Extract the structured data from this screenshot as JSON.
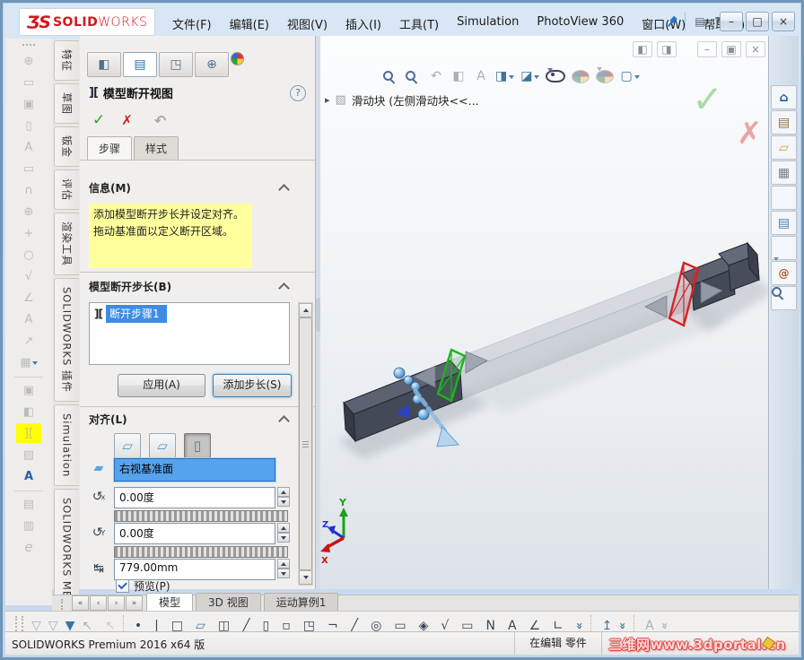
{
  "titlebar": {
    "logo": {
      "mark": "ƷS",
      "bold": "SOLID",
      "light": "WORKS"
    },
    "menus": [
      {
        "n": "menu-file",
        "label": "文件(F)"
      },
      {
        "n": "menu-edit",
        "label": "编辑(E)"
      },
      {
        "n": "menu-view",
        "label": "视图(V)"
      },
      {
        "n": "menu-insert",
        "label": "插入(I)"
      },
      {
        "n": "menu-tools",
        "label": "工具(T)"
      },
      {
        "n": "menu-simulation",
        "label": "Simulation"
      },
      {
        "n": "menu-photoview",
        "label": "PhotoView 360"
      },
      {
        "n": "menu-window",
        "label": "窗口(W)"
      },
      {
        "n": "menu-help",
        "label": "帮助(H)"
      }
    ],
    "quick": [
      {
        "n": "whats-new-icon",
        "g": "▤"
      },
      {
        "n": "help-icon",
        "g": "?"
      },
      {
        "n": "help-dropdown-icon",
        "g": "▾"
      }
    ],
    "controls": [
      {
        "n": "minimize-button",
        "g": "–"
      },
      {
        "n": "maximize-button",
        "g": "□"
      },
      {
        "n": "close-button",
        "g": "×"
      }
    ]
  },
  "left_toolbar": {
    "items": [
      {
        "n": "datum-target-icon",
        "g": "⊕"
      },
      {
        "n": "auto-dimension-icon",
        "g": "▭"
      },
      {
        "n": "basic-dimension-icon",
        "g": "▣"
      },
      {
        "n": "datum-feature-icon",
        "g": "▯"
      },
      {
        "n": "note-pattern-icon",
        "g": "A"
      },
      {
        "n": "dimension-frame-icon",
        "g": "▭"
      },
      {
        "n": "revision-cloud-icon",
        "g": "∩"
      },
      {
        "n": "target-point-icon",
        "g": "⊕"
      },
      {
        "n": "hide-show-annotations-icon",
        "g": "+"
      },
      {
        "n": "magnifying-glass-icon",
        "g": "○"
      },
      {
        "n": "spell-checker-icon",
        "g": "√"
      },
      {
        "n": "weld-symbol-icon",
        "g": "∠"
      },
      {
        "n": "note-icon",
        "g": "A"
      },
      {
        "n": "multi-jog-leader-icon",
        "g": "↗"
      },
      {
        "n": "table-icon",
        "g": "▦",
        "dd": true
      },
      {
        "sep": true
      },
      {
        "n": "camera-3d-icon",
        "g": "▣"
      },
      {
        "n": "section-view-icon",
        "g": "◧"
      },
      {
        "n": "model-break-view-button",
        "g": "][",
        "cls": "hl"
      },
      {
        "n": "display-state-icon",
        "g": "▧"
      },
      {
        "n": "annotation-view-icon",
        "g": "A",
        "cls": "colored"
      },
      {
        "sep": true
      },
      {
        "n": "publish-3dpdf-icon",
        "g": "▤"
      },
      {
        "n": "publish-stl-icon",
        "g": "▥"
      },
      {
        "n": "edrawings-icon",
        "g": "e",
        "cls": "ital"
      }
    ]
  },
  "command_tabs": {
    "items": [
      {
        "n": "tab-features",
        "label": "特征"
      },
      {
        "n": "tab-sketch",
        "label": "草图"
      },
      {
        "n": "tab-sheetmetal",
        "label": "钣金"
      },
      {
        "n": "tab-evaluate",
        "label": "评估"
      },
      {
        "n": "tab-render-tools",
        "label": "渲染工具"
      },
      {
        "n": "tab-solidworks-addins",
        "label": "SOLIDWORKS 插件"
      },
      {
        "n": "tab-simulation",
        "label": "Simulation"
      },
      {
        "n": "tab-solidworks-mbd",
        "label": "SOLIDWORKS MBD"
      }
    ]
  },
  "pm": {
    "manager_tabs": [
      {
        "n": "featuremanager-tab",
        "g": "◧"
      },
      {
        "n": "propertymanager-tab",
        "g": "▤",
        "cls": "active"
      },
      {
        "n": "configurationmanager-tab",
        "g": "◳"
      },
      {
        "n": "dimxpertmanager-tab",
        "g": "⊕"
      },
      {
        "n": "displaymanager-tab",
        "g": "",
        "cls": "ballicon"
      }
    ],
    "title": "模型断开视图",
    "title_icon": "][",
    "help": "?",
    "ok": "✓",
    "cancel": "✗",
    "undo": "↶",
    "subtabs": [
      {
        "n": "subtab-steps",
        "label": "步骤",
        "cls": "active"
      },
      {
        "n": "subtab-style",
        "label": "样式"
      }
    ],
    "info_header": "信息(M)",
    "info_line1": "添加模型断开步长并设定对齐。",
    "info_line2": "拖动基准面以定义断开区域。",
    "steps_header": "模型断开步长(B)",
    "step_icon": "][",
    "step_label": "断开步骤1",
    "apply": "应用(A)",
    "add_step": "添加步长(S)",
    "align_header": "对齐(L)",
    "align_buttons": [
      {
        "n": "align-with-xy-button",
        "g": "▱"
      },
      {
        "n": "align-with-xz-button",
        "g": "▱"
      },
      {
        "n": "align-with-plane-button",
        "g": "▯",
        "cls": "pressed"
      }
    ],
    "plane_icon": "▰",
    "plane_value": "右视基准面",
    "x_icon": "↺",
    "x_sup": "x",
    "x_value": "0.00度",
    "y_icon": "↺",
    "y_sup": "Y",
    "y_value": "0.00度",
    "dist_icon": "↹",
    "dist_value": "779.00mm",
    "preview_label": "预览(P)"
  },
  "viewport": {
    "doc_controls": [
      {
        "n": "pane-left-icon",
        "g": "◧"
      },
      {
        "n": "pane-right-icon",
        "g": "◨"
      },
      {
        "n": "doc-minimize-button",
        "g": "–",
        "cls": "mgap"
      },
      {
        "n": "doc-restore-button",
        "g": "▣"
      },
      {
        "n": "doc-close-button",
        "g": "×"
      }
    ],
    "headsup": [
      {
        "n": "zoom-fit-button",
        "cls": "magicon"
      },
      {
        "n": "zoom-area-button",
        "cls": "magicon"
      },
      {
        "n": "previous-view-button",
        "g": "↶",
        "cls": "grayg"
      },
      {
        "n": "section-view-button",
        "g": "◧",
        "cls": "grayg"
      },
      {
        "n": "annotation-views-button",
        "g": "A",
        "cls": "grayg"
      },
      {
        "n": "view-orientation-button",
        "g": "◨",
        "cls": "blueg",
        "dd": true
      },
      {
        "n": "display-style-button",
        "g": "◪",
        "cls": "blueg",
        "dd": true
      },
      {
        "n": "hide-show-items-button",
        "cls": "eyeicon",
        "dd": true
      },
      {
        "n": "edit-appearance-button",
        "cls": "ballicon dim"
      },
      {
        "n": "apply-scene-button",
        "cls": "ballicon dim",
        "dd": true
      },
      {
        "n": "view-settings-button",
        "g": "▢",
        "cls": "blueg",
        "dd": true
      }
    ],
    "breadcrumb": {
      "expander": "▸",
      "icon": "▧",
      "label": "滑动块 (左侧滑动块<<..."
    },
    "confirm_ok": "✓",
    "confirm_cancel": "✗",
    "triad": {
      "x": "X",
      "y": "Y",
      "z": "Z"
    }
  },
  "taskpane": {
    "items": [
      {
        "n": "resources-home-tab",
        "g": "⌂",
        "cls": "c-home"
      },
      {
        "n": "design-library-tab",
        "g": "▤",
        "cls": "c-lib"
      },
      {
        "n": "file-explorer-tab",
        "g": "▱",
        "cls": "c-folder"
      },
      {
        "n": "view-palette-tab",
        "g": "▦",
        "cls": "c-pal"
      },
      {
        "n": "appearances-tab",
        "g": "",
        "cls": "ballicon"
      },
      {
        "n": "custom-properties-tab",
        "g": "▤",
        "cls": "c-props"
      },
      {
        "n": "forum-tab",
        "g": "",
        "cls": "bubbleicon"
      },
      {
        "n": "xpress-products-tab",
        "g": "@",
        "cls": "c-at"
      },
      {
        "n": "search-tab",
        "g": "",
        "cls": "magicon"
      }
    ]
  },
  "doc_tabs": {
    "nav": [
      {
        "n": "first-tab-button",
        "g": "«"
      },
      {
        "n": "prev-tab-button",
        "g": "‹"
      },
      {
        "n": "next-tab-button",
        "g": "›"
      },
      {
        "n": "last-tab-button",
        "g": "»"
      }
    ],
    "tabs": [
      {
        "n": "tab-model",
        "label": "模型",
        "cls": "active"
      },
      {
        "n": "tab-3d-views",
        "label": "3D 视图"
      },
      {
        "n": "tab-motion-study",
        "label": "运动算例1"
      }
    ]
  },
  "bottom_toolbar": {
    "items": [
      {
        "n": "selection-filter-icon",
        "g": "▽",
        "cls": "grayg"
      },
      {
        "n": "filter-multiple-icon",
        "g": "▽",
        "cls": "grayg"
      },
      {
        "n": "filter-toggle-button",
        "g": "▼",
        "cls": "blueg"
      },
      {
        "n": "select-arrow-button",
        "g": "↖",
        "cls": "grayg",
        "dd": true
      },
      {
        "n": "select-other-button",
        "g": "↖",
        "cls": "grayg2"
      },
      {
        "sep": true
      },
      {
        "n": "sketch-point-button",
        "g": "•",
        "cls": "darkg",
        "dd": true
      },
      {
        "n": "sketch-line-button",
        "g": "|",
        "cls": "darkg",
        "dd": true
      },
      {
        "n": "corner-rectangle-button",
        "g": "□",
        "cls": "darkg",
        "dd": true
      },
      {
        "n": "reference-geometry-button",
        "g": "▱",
        "cls": "blueg",
        "dd": true
      },
      {
        "n": "extruded-boss-button",
        "g": "◫",
        "cls": "darkg",
        "dd": true
      },
      {
        "n": "sketch3d-button",
        "g": "╱",
        "cls": "darkg",
        "dd": true
      },
      {
        "n": "plane-button",
        "g": "▯",
        "cls": "darkg",
        "dd": true
      },
      {
        "n": "point-button",
        "g": "▫",
        "cls": "darkg",
        "dd": true
      },
      {
        "n": "corner-rect-grid-button",
        "g": "◳",
        "cls": "darkg",
        "dd": true
      },
      {
        "n": "centerline-button",
        "g": "¬",
        "cls": "darkg",
        "dd": true
      },
      {
        "n": "line-button",
        "g": "╱",
        "cls": "darkg",
        "dd": true
      },
      {
        "n": "circle-button",
        "g": "◎",
        "cls": "darkg",
        "dd": true
      },
      {
        "n": "smart-dimension-button",
        "g": "▭",
        "cls": "darkg",
        "dd": true
      },
      {
        "n": "decal-button",
        "g": "◈",
        "cls": "darkg",
        "dd": true
      },
      {
        "n": "equation-button",
        "g": "√",
        "cls": "darkg",
        "dd": true
      },
      {
        "n": "tolerance-button",
        "g": "▭",
        "cls": "darkg",
        "dd": true
      },
      {
        "n": "magnifier-n-button",
        "g": "N",
        "cls": "darkg",
        "dd": true
      },
      {
        "n": "note-button",
        "g": "A",
        "cls": "darkg",
        "dd": true
      },
      {
        "n": "weld-symbol-button",
        "g": "∠",
        "cls": "darkg",
        "dd": true
      },
      {
        "n": "surface-finish-button",
        "g": "∟",
        "cls": "darkg",
        "dd": true
      },
      {
        "n": "more-tools-chevron",
        "g": "»",
        "cls": "blueg rot90"
      },
      {
        "sep": true
      },
      {
        "n": "instant3d-button",
        "g": "↥",
        "cls": "blueg"
      },
      {
        "n": "features-chevron",
        "g": "»",
        "cls": "blueg rot90"
      },
      {
        "sep": true
      },
      {
        "n": "format-painter-button",
        "g": "A",
        "cls": "grayg"
      },
      {
        "n": "hidden-chevron",
        "g": "»",
        "cls": "grayg rot90"
      }
    ]
  },
  "status": {
    "left": "SOLIDWORKS Premium 2016 x64 版",
    "mode": "在编辑 零件",
    "watermark": "三维网www.3dportal.cn"
  }
}
